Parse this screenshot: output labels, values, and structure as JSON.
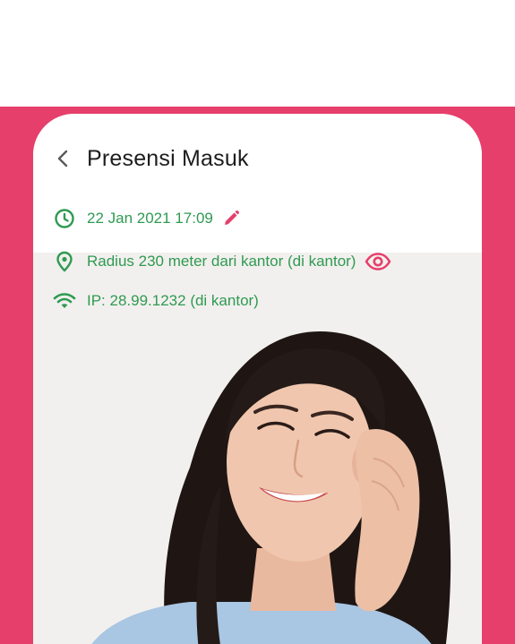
{
  "header": {
    "title": "Presensi Masuk"
  },
  "info": {
    "datetime": "22 Jan 2021 17:09",
    "radius": "Radius 230 meter dari kantor (di kantor)",
    "ip": "IP: 28.99.1232 (di kantor)"
  },
  "icons": {
    "back": "chevron-left-icon",
    "clock": "clock-icon",
    "edit": "pencil-icon",
    "location": "map-pin-icon",
    "view": "eye-icon",
    "wifi": "wifi-icon"
  },
  "colors": {
    "brand_pink": "#e63f6b",
    "status_green": "#2f9a52",
    "title_text": "#1d1d1f"
  }
}
